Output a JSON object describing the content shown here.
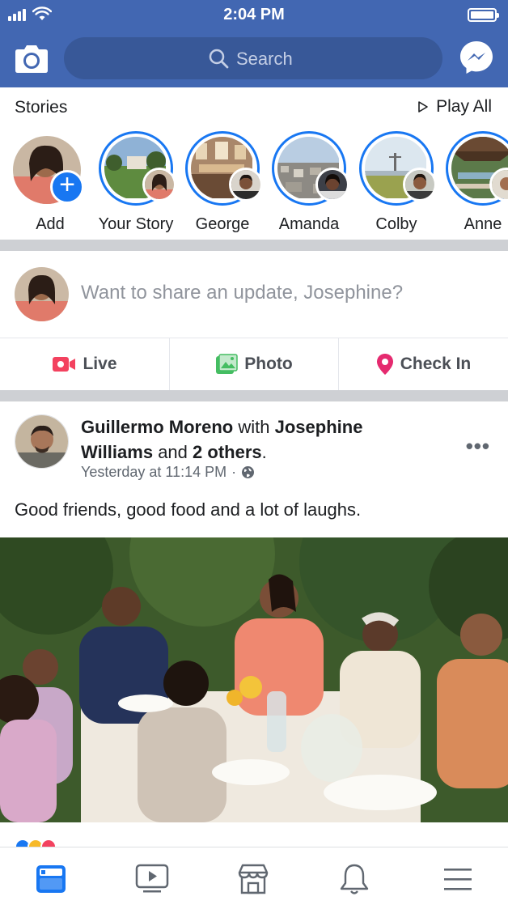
{
  "status_bar": {
    "time": "2:04 PM",
    "battery_level": 0.95
  },
  "header": {
    "search_placeholder": "Search",
    "camera_icon": "camera-icon",
    "messenger_icon": "messenger-icon"
  },
  "stories": {
    "title": "Stories",
    "play_all_label": "Play All",
    "items": [
      {
        "name": "Add"
      },
      {
        "name": "Your Story"
      },
      {
        "name": "George"
      },
      {
        "name": "Amanda"
      },
      {
        "name": "Colby"
      },
      {
        "name": "Anne"
      }
    ]
  },
  "composer": {
    "prompt": "Want to share an update, Josephine?"
  },
  "actions": {
    "live_label": "Live",
    "photo_label": "Photo",
    "checkin_label": "Check In"
  },
  "post": {
    "author": "Guillermo Moreno",
    "with_word": "with",
    "tagged": "Josephine Williams",
    "and_word": "and",
    "others": "2 others",
    "timestamp": "Yesterday at 11:14 PM",
    "privacy_icon": "globe-icon",
    "caption": "Good friends, good food and a lot of laughs."
  },
  "colors": {
    "brand_blue": "#4267b2",
    "accent_blue": "#1877f2",
    "live_red": "#f3425f",
    "photo_green": "#45bd62",
    "checkin_pink": "#e52a6f"
  },
  "tabbar": {
    "items": [
      "news-feed-icon",
      "watch-icon",
      "marketplace-icon",
      "notifications-icon",
      "menu-icon"
    ],
    "active": "news-feed-icon"
  }
}
